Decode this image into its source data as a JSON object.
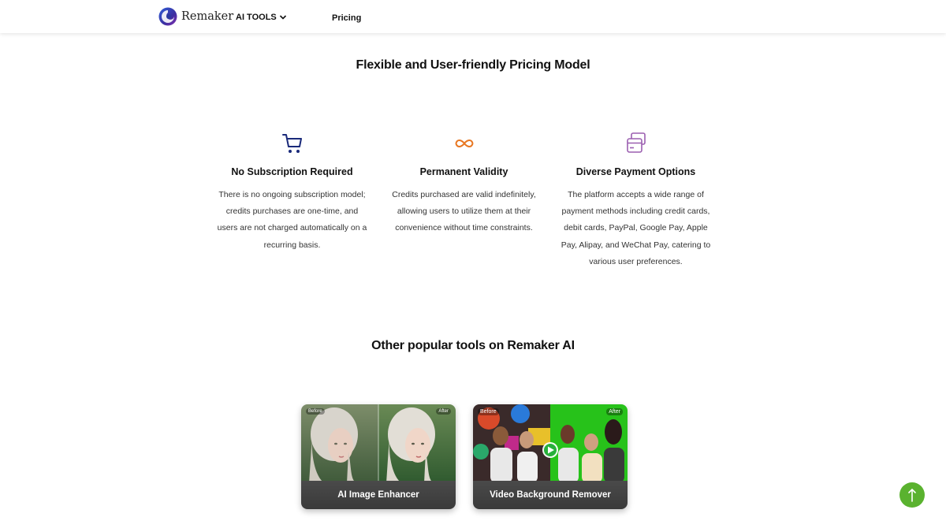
{
  "header": {
    "brand": "Remaker",
    "nav_tools": "AI TOOLS",
    "nav_pricing": "Pricing"
  },
  "pricing": {
    "title": "Flexible and User-friendly Pricing Model",
    "features": [
      {
        "title": "No Subscription Required",
        "description": "There is no ongoing subscription model; credits purchases are one-time, and users are not charged automatically on a recurring basis.",
        "icon": "cart-icon",
        "icon_color": "#1a2a7a"
      },
      {
        "title": "Permanent Validity",
        "description": "Credits purchased are valid indefinitely, allowing users to utilize them at their convenience without time constraints.",
        "icon": "infinity-icon",
        "icon_color": "#e87722"
      },
      {
        "title": "Diverse Payment Options",
        "description": "The platform accepts a wide range of payment methods including credit cards, debit cards, PayPal, Google Pay, Apple Pay, Alipay, and WeChat Pay, catering to various user preferences.",
        "icon": "payment-cards-icon",
        "icon_color": "#9b5fb0"
      }
    ]
  },
  "tools": {
    "title": "Other popular tools on Remaker AI",
    "cards": [
      {
        "label": "AI Image Enhancer",
        "before": "Before",
        "after": "After"
      },
      {
        "label": "Video Background Remover",
        "before": "Before",
        "after": "After"
      }
    ]
  },
  "scroll_top_icon": "arrow-up-icon",
  "accent_color": "#5ab22f"
}
